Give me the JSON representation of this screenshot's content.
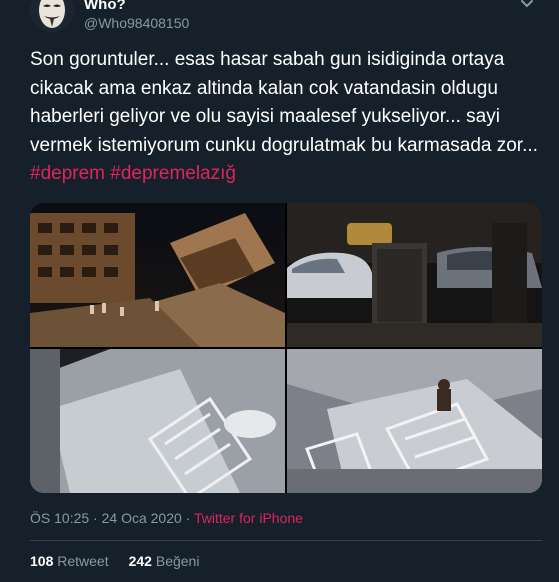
{
  "user": {
    "display_name": "Who?",
    "handle": "@Who98408150"
  },
  "tweet": {
    "text": "Son goruntuler... esas hasar sabah gun isidiginda ortaya cikacak ama enkaz altinda kalan cok vatandasin oldugu haberleri geliyor ve olu sayisi maalesef yukseliyor... sayi vermek istemiyorum cunku dogrulatmak bu karmasada zor...",
    "hashtags": [
      "#deprem",
      "#depremelazığ"
    ]
  },
  "meta": {
    "time": "ÖS 10:25",
    "separator": "·",
    "date": "24 Oca 2020",
    "dot": "·",
    "source": "Twitter for iPhone"
  },
  "stats": {
    "retweet_count": "108",
    "retweet_label": "Retweet",
    "like_count": "242",
    "like_label": "Beğeni"
  },
  "icons": {
    "more": "chevron-down-icon"
  },
  "colors": {
    "background": "#15202b",
    "text": "#ffffff",
    "muted": "#8899a6",
    "accent": "#e0245e",
    "divider": "#38444d"
  }
}
